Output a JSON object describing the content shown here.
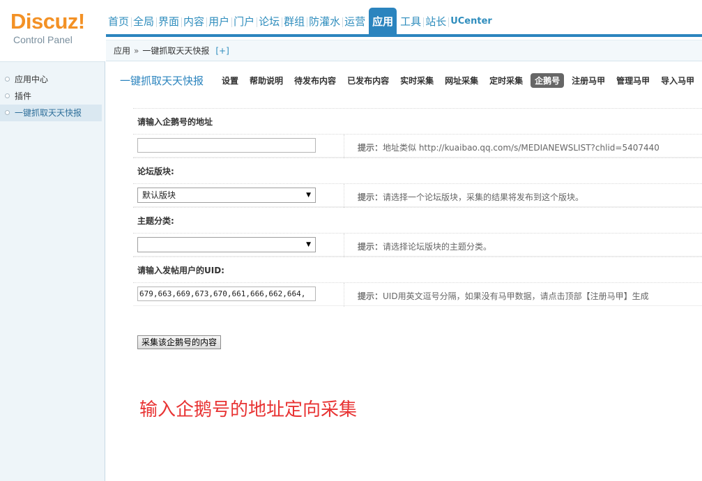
{
  "logo": {
    "main": "Discuz!",
    "sub": "Control Panel"
  },
  "topnav": {
    "items": [
      "首页",
      "全局",
      "界面",
      "内容",
      "用户",
      "门户",
      "论坛",
      "群组",
      "防灌水",
      "运营",
      "应用",
      "工具",
      "站长",
      "UCenter"
    ],
    "active": "应用"
  },
  "breadcrumb": {
    "root": "应用",
    "separator": "»",
    "current": "一键抓取天天快报",
    "plus": "[+]"
  },
  "sidebar": {
    "items": [
      {
        "label": "应用中心"
      },
      {
        "label": "插件"
      },
      {
        "label": "一键抓取天天快报"
      }
    ]
  },
  "plugin": {
    "title": "一键抓取天天快报",
    "tabs": [
      "设置",
      "帮助说明",
      "待发布内容",
      "已发布内容",
      "实时采集",
      "网址采集",
      "定时采集",
      "企鹅号",
      "注册马甲",
      "管理马甲",
      "导入马甲"
    ],
    "active_tab": "企鹅号"
  },
  "form": {
    "address": {
      "label": "请输入企鹅号的地址",
      "value": "",
      "tip_label": "提示：",
      "tip": "地址类似 http://kuaibao.qq.com/s/MEDIANEWSLIST?chlid=5407440"
    },
    "forum": {
      "label": "论坛版块:",
      "selected": "默认版块",
      "tip_label": "提示：",
      "tip": "请选择一个论坛版块，采集的结果将发布到这个版块。"
    },
    "category": {
      "label": "主题分类:",
      "selected": "",
      "tip_label": "提示：",
      "tip": "请选择论坛版块的主题分类。"
    },
    "uid": {
      "label": "请输入发帖用户的UID:",
      "value": "679,663,669,673,670,661,666,662,664,",
      "tip_label": "提示：",
      "tip": "UID用英文逗号分隔，如果没有马甲数据，请点击顶部【注册马甲】生成"
    },
    "submit_label": "采集该企鹅号的内容"
  },
  "annotation": "输入企鹅号的地址定向采集",
  "colors": {
    "accent": "#2b84be",
    "logo": "#f39125",
    "annotation": "#e83333"
  }
}
